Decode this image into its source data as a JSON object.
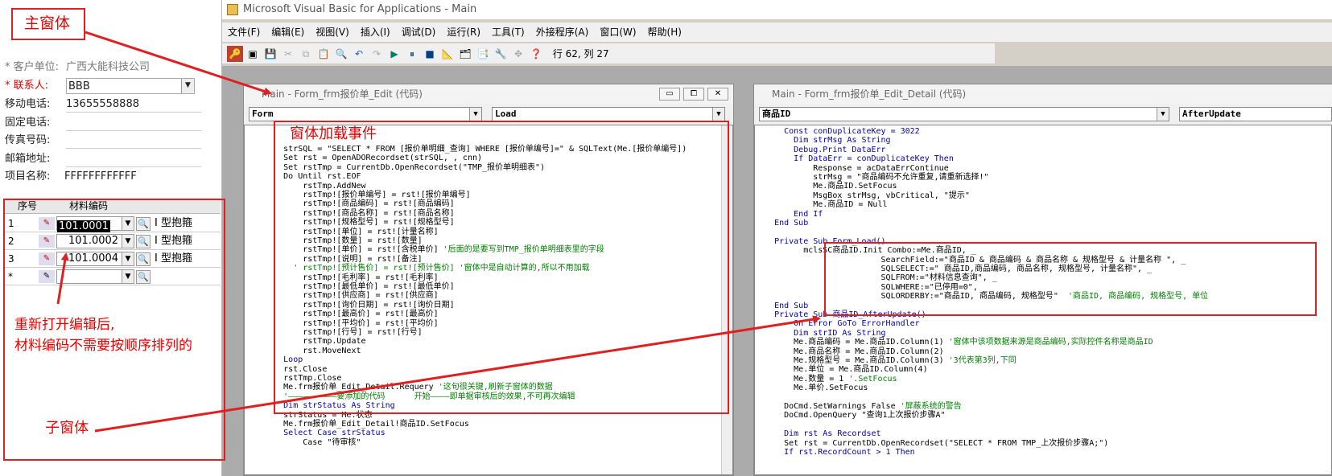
{
  "form": {
    "customer_label": "* 客户单位:",
    "customer_value": "广西大能科技公司",
    "contact_label": "* 联系人:",
    "contact_value": "BBB",
    "mobile_label": "移动电话:",
    "mobile_value": "13655558888",
    "phone_label": "固定电话:",
    "fax_label": "传真号码:",
    "email_label": "邮箱地址:",
    "project_label": "项目名称:",
    "project_value": "FFFFFFFFFFFF",
    "grid_headers": [
      "序号",
      "材料编码"
    ],
    "rows": [
      {
        "no": "1",
        "code": "101.0001",
        "name": "I 型抱箍"
      },
      {
        "no": "2",
        "code": "101.0002",
        "name": "I 型抱箍"
      },
      {
        "no": "3",
        "code": "101.0004",
        "name": "I 型抱箍"
      },
      {
        "no": "*",
        "code": "",
        "name": ""
      }
    ]
  },
  "vba": {
    "title": "Microsoft Visual Basic for Applications - Main",
    "menus": [
      "文件(F)",
      "编辑(E)",
      "视图(V)",
      "插入(I)",
      "调试(D)",
      "运行(R)",
      "工具(T)",
      "外接程序(A)",
      "窗口(W)",
      "帮助(H)"
    ],
    "status": "行 62, 列 27"
  },
  "win1": {
    "title": "Main - Form_frm报价单_Edit (代码)",
    "object": "Form",
    "proc": "Load",
    "lines": [
      [
        "",
        "        strSQL = \"SELECT * FROM [报价单明细_查询] WHERE [报价单编号]=\" & SQLText(Me.[报价单编号])"
      ],
      [
        "",
        "        Set rst = OpenADORecordset(strSQL, , cnn)"
      ],
      [
        "",
        "        Set rstTmp = CurrentDb.OpenRecordset(\"TMP_报价单明细表\")"
      ],
      [
        "",
        "        Do Until rst.EOF"
      ],
      [
        "",
        "            rstTmp.AddNew"
      ],
      [
        "",
        "            rstTmp![报价单编号] = rst![报价单编号]"
      ],
      [
        "",
        "            rstTmp![商品编码] = rst![商品编码]"
      ],
      [
        "",
        "            rstTmp![商品名称] = rst![商品名称]"
      ],
      [
        "",
        "            rstTmp![规格型号] = rst![规格型号]"
      ],
      [
        "",
        "            rstTmp![单位] = rst![计量名称]"
      ],
      [
        "",
        "            rstTmp![数量] = rst![数量]"
      ],
      [
        "c",
        "            rstTmp![单价] = rst![含税单价] '后面的是要写到TMP_报价单明细表里的字段"
      ],
      [
        "",
        "            rstTmp![说明] = rst![备注]"
      ],
      [
        "cm",
        "          ' rstTmp![预计售价] = rst![预计售价] '窗体中是自动计算的,所以不用加载"
      ],
      [
        "",
        "            rstTmp![毛利率] = rst![毛利率]"
      ],
      [
        "",
        "            rstTmp![最低单价] = rst![最低单价]"
      ],
      [
        "",
        "            rstTmp![供应商] = rst![供应商]"
      ],
      [
        "",
        "            rstTmp![询价日期] = rst![询价日期]"
      ],
      [
        "",
        "            rstTmp![最高价] = rst![最高价]"
      ],
      [
        "",
        "            rstTmp![平均价] = rst![平均价]"
      ],
      [
        "",
        "            rstTmp![行号] = rst![行号]"
      ],
      [
        "",
        "            rstTmp.Update"
      ],
      [
        "",
        "            rst.MoveNext"
      ],
      [
        "k",
        "        Loop"
      ],
      [
        "",
        "        rst.Close"
      ],
      [
        "",
        "        rstTmp.Close"
      ],
      [
        "c",
        "        Me.frm报价单_Edit_Detail.Requery '这句很关键,刷新子窗体的数据"
      ],
      [
        "cm",
        "        '——————————要添加的代码      开始————即单据审核后的效果,不可再次编辑"
      ],
      [
        "k",
        "        Dim strStatus As String"
      ],
      [
        "",
        "        strStatus = Me.状态"
      ],
      [
        "",
        "        Me.frm报价单_Edit_Detail!商品ID.SetFocus"
      ],
      [
        "k",
        "        Select Case strStatus"
      ],
      [
        "",
        "            Case \"待审核\""
      ]
    ]
  },
  "win2": {
    "title": "Main - Form_frm报价单_Edit_Detail (代码)",
    "object": "商品ID",
    "proc": "AfterUpdate",
    "lines": [
      [
        "k",
        "      Const conDuplicateKey = 3022"
      ],
      [
        "k",
        "        Dim strMsg As String"
      ],
      [
        "k",
        "        Debug.Print DataErr"
      ],
      [
        "k",
        "        If DataErr = conDuplicateKey Then"
      ],
      [
        "",
        "            Response = acDataErrContinue"
      ],
      [
        "",
        "            strMsg = \"商品编码不允许重复,请重新选择!\""
      ],
      [
        "",
        "            Me.商品ID.SetFocus"
      ],
      [
        "",
        "            MsgBox strMsg, vbCritical, \"提示\""
      ],
      [
        "",
        "            Me.商品ID = Null"
      ],
      [
        "k",
        "        End If"
      ],
      [
        "k",
        "    End Sub"
      ],
      [
        "",
        ""
      ],
      [
        "k",
        "    Private Sub Form_Load()"
      ],
      [
        "",
        "          mclsSC商品ID.Init Combo:=Me.商品ID, _"
      ],
      [
        "",
        "                          SearchField:=\"商品ID & 商品编码 & 商品名称 & 规格型号 & 计量名称 \", _"
      ],
      [
        "",
        "                          SQLSELECT:=\" 商品ID,商品编码, 商品名称, 规格型号, 计量名称\", _"
      ],
      [
        "",
        "                          SQLFROM:=\"材料信息查询\", _"
      ],
      [
        "",
        "                          SQLWHERE:=\"已停用=0\", _"
      ],
      [
        "c",
        "                          SQLORDERBY:=\"商品ID, 商品编码, 规格型号\"  '商品ID, 商品编码, 规格型号, 单位"
      ],
      [
        "k",
        "    End Sub"
      ],
      [
        "k",
        "    Private Sub 商品ID_AfterUpdate()"
      ],
      [
        "k",
        "        On Error GoTo ErrorHandler"
      ],
      [
        "k",
        "        Dim strID As String"
      ],
      [
        "c",
        "        Me.商品编码 = Me.商品ID.Column(1) '窗体中该项数据来源是商品编码,实际控件名称是商品ID"
      ],
      [
        "",
        "        Me.商品名称 = Me.商品ID.Column(2)"
      ],
      [
        "c",
        "        Me.规格型号 = Me.商品ID.Column(3) '3代表第3列,下同"
      ],
      [
        "",
        "        Me.单位 = Me.商品ID.Column(4)"
      ],
      [
        "c",
        "        Me.数量 = 1 '.SetFocus"
      ],
      [
        "",
        "        Me.单价.SetFocus"
      ],
      [
        "",
        ""
      ],
      [
        "c",
        "      DoCmd.SetWarnings False '屏蔽系统的警告"
      ],
      [
        "",
        "      DoCmd.OpenQuery \"查询1上次报价步骤A\""
      ],
      [
        "",
        ""
      ],
      [
        "k",
        "      Dim rst As Recordset"
      ],
      [
        "",
        "      Set rst = CurrentDb.OpenRecordset(\"SELECT * FROM TMP_上次报价步骤A;\")"
      ],
      [
        "k",
        "      If rst.RecordCount > 1 Then"
      ]
    ]
  },
  "annotations": {
    "main_window": "主窗体",
    "load_event": "窗体加载事件",
    "note_line1": "重新打开编辑后,",
    "note_line2": "材料编码不需要按顺序排列的",
    "subform": "子窗体"
  },
  "colors": {
    "annotation": "#e02020",
    "keyword": "#0000b0",
    "comment": "#008000"
  }
}
